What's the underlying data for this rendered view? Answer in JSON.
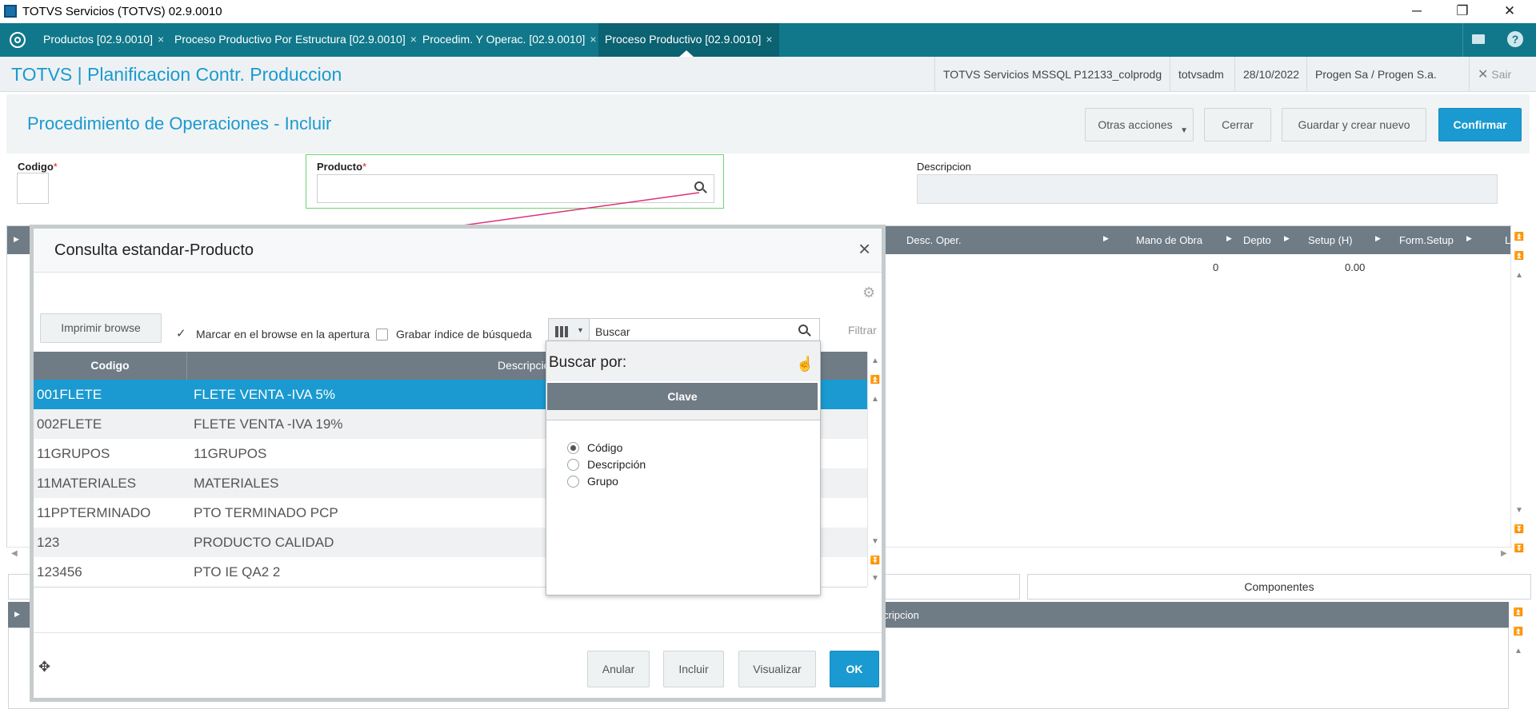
{
  "window": {
    "title": "TOTVS Servicios (TOTVS) 02.9.0010",
    "minimize": "─",
    "restore": "❐",
    "close": "✕"
  },
  "tabs": [
    {
      "label": "Productos [02.9.0010]",
      "close": "×"
    },
    {
      "label": "Proceso Productivo Por Estructura [02.9.0010]",
      "close": "×"
    },
    {
      "label": "Procedim. Y Operac. [02.9.0010]",
      "close": "×"
    },
    {
      "label": "Proceso Productivo [02.9.0010]",
      "close": "×"
    }
  ],
  "header": {
    "app_title": "TOTVS | Planificacion Contr. Produccion",
    "environment": "TOTVS Servicios MSSQL P12133_colprodg",
    "user": "totvsadm",
    "date": "28/10/2022",
    "company": "Progen Sa / Progen S.a.",
    "exit_label": "Sair"
  },
  "page": {
    "title": "Procedimiento de Operaciones - Incluir",
    "buttons": {
      "other_actions": "Otras acciones",
      "close": "Cerrar",
      "save_new": "Guardar y crear nuevo",
      "confirm": "Confirmar"
    }
  },
  "form": {
    "codigo_label": "Codigo",
    "producto_label": "Producto",
    "descripcion_label": "Descripcion",
    "required_mark": "*"
  },
  "background_grid": {
    "headers": [
      "Desc. Oper.",
      "Mano de Obra",
      "Depto",
      "Setup (H)",
      "Form.Setup",
      "L"
    ],
    "row": {
      "mano_de_obra": "0",
      "setup": "0.00"
    },
    "tab_components": "Componentes",
    "lower_header": "cripcion"
  },
  "modal": {
    "title": "Consulta estandar-Producto",
    "close": "×",
    "print_browse": "Imprimir browse",
    "check_mark_label": "Marcar en el browse en la apertura",
    "check_mark_checked": true,
    "check_save_label": "Grabar índice de búsqueda",
    "check_save_checked": false,
    "search_placeholder": "Buscar",
    "filter_label": "Filtrar",
    "columns": [
      "Codigo",
      "Descripcio"
    ],
    "rows": [
      {
        "code": "001FLETE",
        "desc": "FLETE VENTA -IVA 5%"
      },
      {
        "code": "002FLETE",
        "desc": "FLETE VENTA -IVA 19%"
      },
      {
        "code": "11GRUPOS",
        "desc": "11GRUPOS"
      },
      {
        "code": "11MATERIALES",
        "desc": "MATERIALES"
      },
      {
        "code": "11PPTERMINADO",
        "desc": "PTO TERMINADO PCP"
      },
      {
        "code": "123",
        "desc": "PRODUCTO CALIDAD"
      },
      {
        "code": "123456",
        "desc": "PTO IE QA2 2"
      }
    ],
    "selected_row": 0,
    "footer": {
      "cancel": "Anular",
      "include": "Incluir",
      "view": "Visualizar",
      "ok": "OK"
    }
  },
  "search_dropdown": {
    "title": "Buscar por:",
    "section": "Clave",
    "options": [
      "Código",
      "Descripción",
      "Grupo"
    ],
    "selected_option": 0
  },
  "colors": {
    "tabbar": "#10788a",
    "accent": "#1a9ad0",
    "selected_row": "#1a9ad0",
    "arrow": "#e0307a"
  }
}
